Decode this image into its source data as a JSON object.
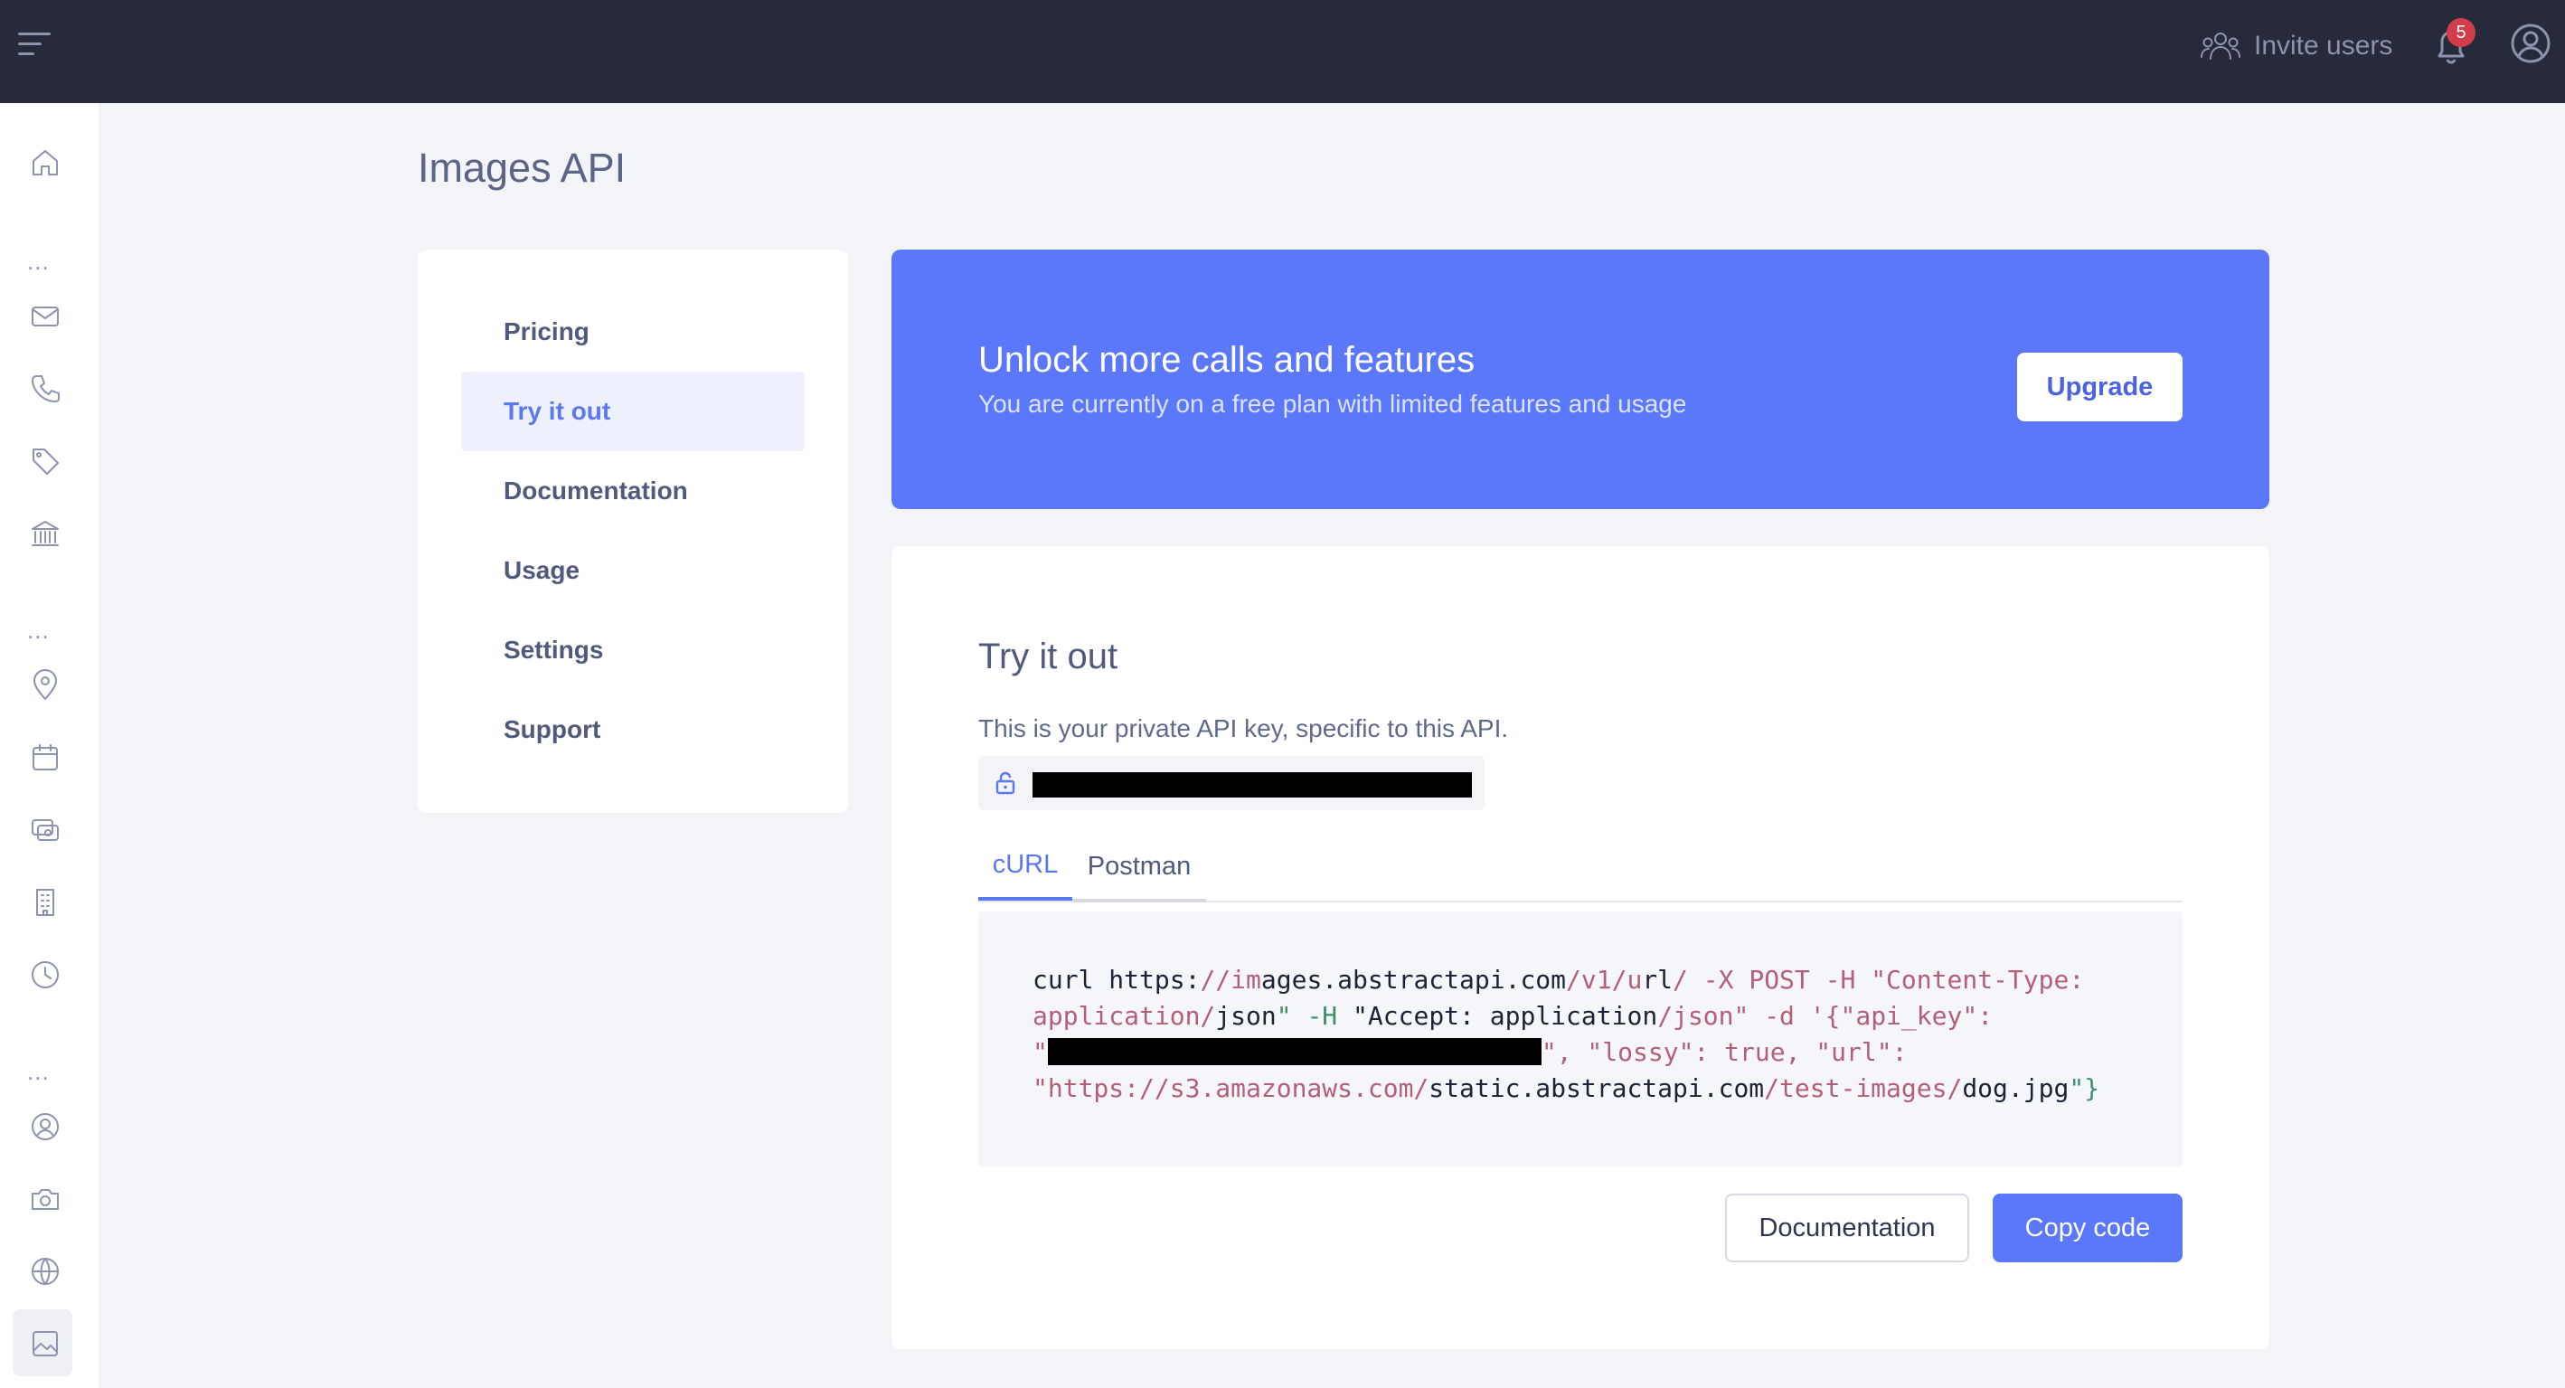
{
  "topbar": {
    "invite_label": "Invite users",
    "notification_count": "5"
  },
  "sidebar": {
    "items": [
      {
        "icon": "home-icon"
      },
      {
        "icon": "mail-icon"
      },
      {
        "icon": "phone-icon"
      },
      {
        "icon": "tag-icon"
      },
      {
        "icon": "bank-icon"
      },
      {
        "icon": "map-pin-icon"
      },
      {
        "icon": "calendar-icon"
      },
      {
        "icon": "currency-exchange-icon"
      },
      {
        "icon": "building-icon"
      },
      {
        "icon": "clock-icon"
      },
      {
        "icon": "user-circle-icon"
      },
      {
        "icon": "camera-icon"
      },
      {
        "icon": "globe-icon"
      },
      {
        "icon": "image-icon",
        "active": true
      }
    ],
    "dots": "..."
  },
  "page": {
    "title": "Images API"
  },
  "nav": {
    "items": [
      {
        "label": "Pricing"
      },
      {
        "label": "Try it out",
        "active": true
      },
      {
        "label": "Documentation"
      },
      {
        "label": "Usage"
      },
      {
        "label": "Settings"
      },
      {
        "label": "Support"
      }
    ]
  },
  "banner": {
    "title": "Unlock more calls and features",
    "subtitle": "You are currently on a free plan with limited features and usage",
    "button": "Upgrade"
  },
  "try": {
    "title": "Try it out",
    "description": "This is your private API key, specific to this API.",
    "tabs": [
      {
        "label": "cURL",
        "active": true
      },
      {
        "label": "Postman"
      }
    ],
    "code": {
      "l1_a": "curl https:",
      "l1_b": "//im",
      "l1_c": "ages.abstractapi.com",
      "l1_d": "/v1/u",
      "l1_e": "rl",
      "l1_f": "/ -X POST -H ",
      "l1_g": "\"Content-Type:",
      "l2_a": "application/",
      "l2_b": "json",
      "l2_c": "\" -H ",
      "l2_d": "\"Accept: application",
      "l2_e": "/json\" -d '{\"api_key\":",
      "l3_a": "\"",
      "l3_b": "\", \"lossy\": true, \"url\":",
      "l4_a": "\"https://s3.amazonaws.com/",
      "l4_b": "static.abstractapi.com",
      "l4_c": "/test-images/",
      "l4_d": "dog.jpg",
      "l4_e": "\"}"
    },
    "documentation_button": "Documentation",
    "copy_button": "Copy code"
  },
  "colors": {
    "accent": "#5b78fb",
    "topbar": "#262a3b",
    "badge": "#d33c4a"
  }
}
